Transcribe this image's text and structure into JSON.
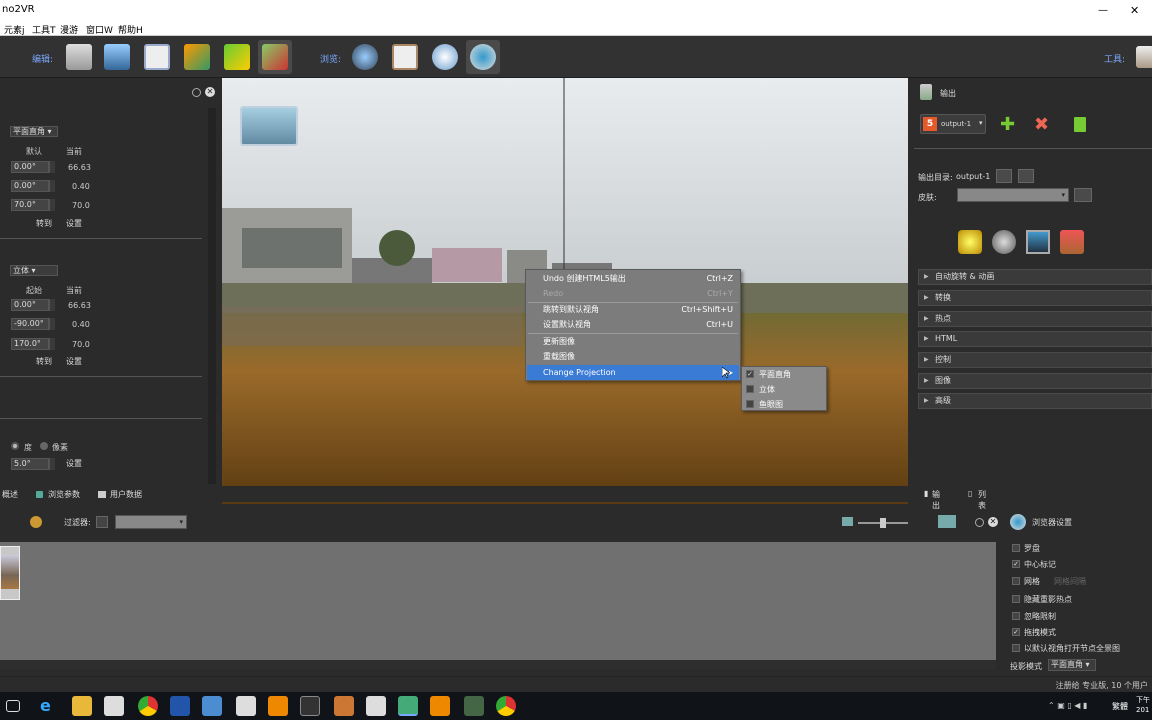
{
  "window": {
    "title": "no2VR"
  },
  "menubar": [
    "元素j",
    "工具T",
    "漫游",
    "窗口W",
    "帮助H"
  ],
  "toolbar": {
    "edit_label": "编辑:",
    "browse_label": "浏览:",
    "tools_label": "工具:"
  },
  "left_panel": {
    "projection1": "平面直角",
    "col_default": "默认",
    "col_current": "当前",
    "rows1": [
      {
        "in": "0.00°",
        "cur": "66.63"
      },
      {
        "in": "0.00°",
        "cur": "0.40"
      },
      {
        "in": "70.0°",
        "cur": "70.0"
      }
    ],
    "goto": "转到",
    "set": "设置",
    "projection2": "立体",
    "col_start": "起始",
    "col_current2": "当前",
    "rows2": [
      {
        "in": "0.00°",
        "cur": "66.63"
      },
      {
        "in": "-90.00°",
        "cur": "0.40"
      },
      {
        "in": "170.0°",
        "cur": "70.0"
      }
    ],
    "unit_deg": "度",
    "unit_px": "像素",
    "bottom_val": "5.0°"
  },
  "context_menu": {
    "items": [
      {
        "label": "Undo 创建HTML5输出",
        "shortcut": "Ctrl+Z"
      },
      {
        "label": "Redo",
        "shortcut": "Ctrl+Y"
      },
      {
        "label": "跳转到默认视角",
        "shortcut": "Ctrl+Shift+U"
      },
      {
        "label": "设置默认视角",
        "shortcut": "Ctrl+U"
      },
      {
        "label": "更新图像",
        "shortcut": ""
      },
      {
        "label": "重载图像",
        "shortcut": ""
      },
      {
        "label": "Change Projection",
        "shortcut": ""
      }
    ],
    "submenu": [
      {
        "label": "平面直角",
        "checked": true
      },
      {
        "label": "立体",
        "checked": false
      },
      {
        "label": "鱼眼图",
        "checked": false
      }
    ]
  },
  "right_panel": {
    "title": "输出",
    "output_name": "output-1",
    "output_dir_label": "输出目录:",
    "output_dir_value": "output-1",
    "skin_label": "皮肤:",
    "sections": [
      "自动旋转 & 动画",
      "转换",
      "热点",
      "HTML",
      "控制",
      "图像",
      "高级"
    ]
  },
  "tabs": {
    "overview": "概述",
    "viewer_params": "浏览参数",
    "user_data": "用户数据",
    "output": "输出",
    "list_view": "列表视图"
  },
  "bottom": {
    "filter_label": "过滤器:",
    "viewer_settings": "浏览器设置"
  },
  "viewer_settings": {
    "items": [
      {
        "label": "罗盘",
        "checked": false
      },
      {
        "label": "中心标记",
        "checked": true
      },
      {
        "label": "网格",
        "checked": false,
        "extra": "网格间隔"
      },
      {
        "label": "隐藏重影热点",
        "checked": false
      },
      {
        "label": "忽略限制",
        "checked": false
      },
      {
        "label": "拖拽模式",
        "checked": true
      },
      {
        "label": "以默认视角打开节点全景图",
        "checked": false
      }
    ],
    "projection_label": "投影模式",
    "projection_value": "平面直角"
  },
  "status": {
    "text": "注册给 专业版, 10 个用户"
  },
  "taskbar": {
    "lang": "繁體",
    "time": "下午",
    "date": "201"
  },
  "colors": {
    "accent": "#3a7bd5",
    "label_blue": "#7aa9ff"
  }
}
